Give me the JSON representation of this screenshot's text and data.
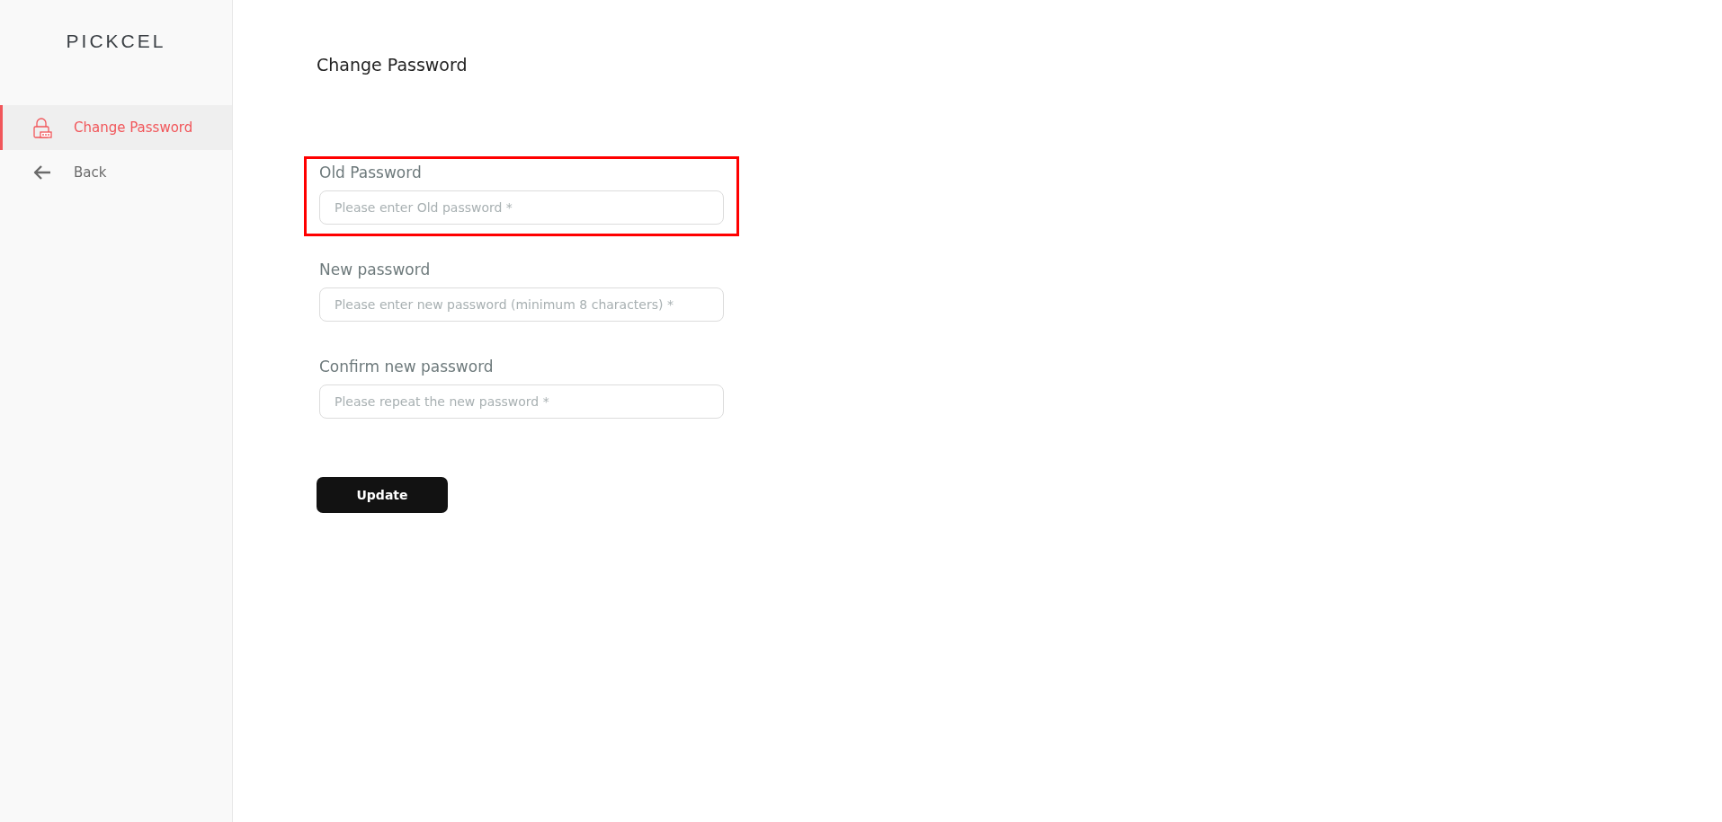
{
  "sidebar": {
    "logo": "PICKCEL",
    "items": [
      {
        "label": "Change Password",
        "kind": "lock",
        "selected": true
      },
      {
        "label": "Back",
        "kind": "back",
        "selected": false
      }
    ]
  },
  "page": {
    "title": "Change Password"
  },
  "fields": [
    {
      "label": "Old Password",
      "placeholder": "Please enter Old password *",
      "highlighted": true
    },
    {
      "label": "New password",
      "placeholder": "Please enter new password (minimum 8 characters) *",
      "highlighted": false
    },
    {
      "label": "Confirm new password",
      "placeholder": "Please repeat the new password *",
      "highlighted": false
    }
  ],
  "buttons": [
    "Update"
  ]
}
